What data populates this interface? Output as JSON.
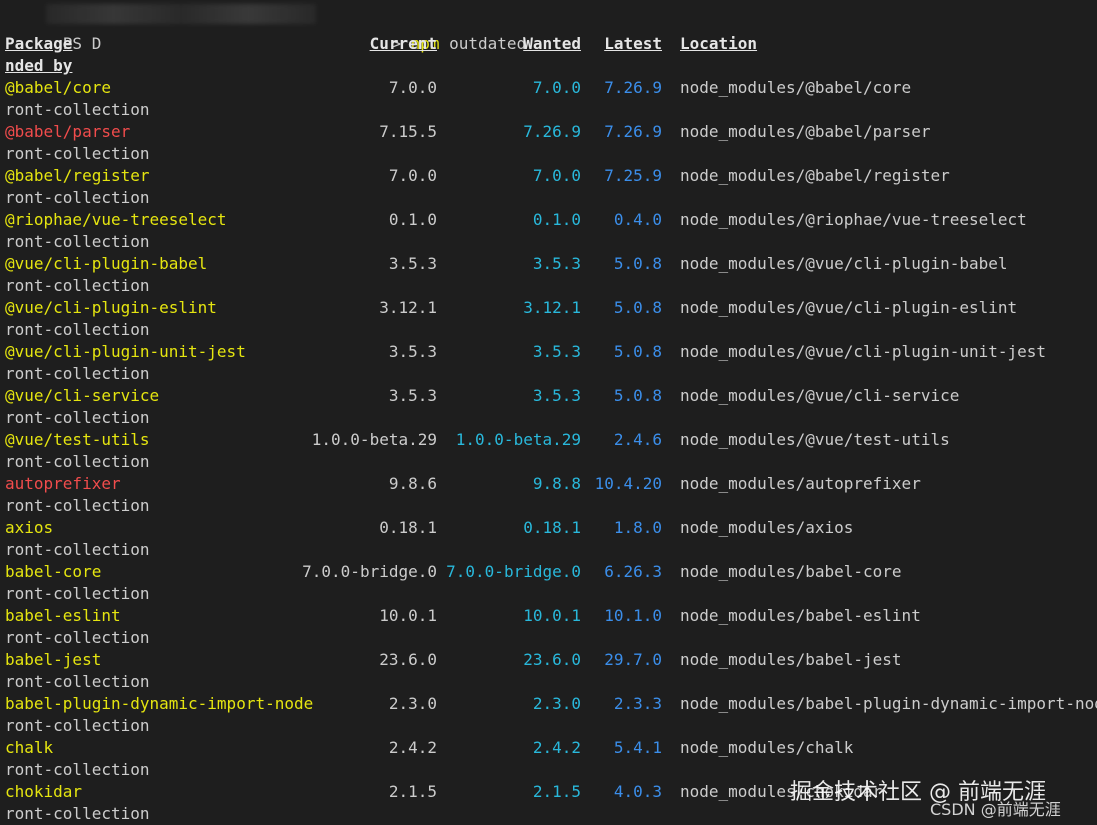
{
  "prompt": {
    "ps": "PS D",
    "gt": "> ",
    "cmd": "npm",
    "arg": " outdated"
  },
  "headers": {
    "package": "Package",
    "current": "Current",
    "wanted": "Wanted",
    "latest": "Latest",
    "location": "Location",
    "depended_by": "nded by"
  },
  "rows": [
    {
      "package": "@babel/core",
      "current": "7.0.0",
      "wanted": "7.0.0",
      "latest": "7.26.9",
      "location": "node_modules/@babel/core",
      "dep": "ront-collection",
      "color": "yellow"
    },
    {
      "package": "@babel/parser",
      "current": "7.15.5",
      "wanted": "7.26.9",
      "latest": "7.26.9",
      "location": "node_modules/@babel/parser",
      "dep": "ront-collection",
      "color": "red"
    },
    {
      "package": "@babel/register",
      "current": "7.0.0",
      "wanted": "7.0.0",
      "latest": "7.25.9",
      "location": "node_modules/@babel/register",
      "dep": "ront-collection",
      "color": "yellow"
    },
    {
      "package": "@riophae/vue-treeselect",
      "current": "0.1.0",
      "wanted": "0.1.0",
      "latest": "0.4.0",
      "location": "node_modules/@riophae/vue-treeselect",
      "dep": "ront-collection",
      "color": "yellow"
    },
    {
      "package": "@vue/cli-plugin-babel",
      "current": "3.5.3",
      "wanted": "3.5.3",
      "latest": "5.0.8",
      "location": "node_modules/@vue/cli-plugin-babel",
      "dep": "ront-collection",
      "color": "yellow"
    },
    {
      "package": "@vue/cli-plugin-eslint",
      "current": "3.12.1",
      "wanted": "3.12.1",
      "latest": "5.0.8",
      "location": "node_modules/@vue/cli-plugin-eslint",
      "dep": "ront-collection",
      "color": "yellow"
    },
    {
      "package": "@vue/cli-plugin-unit-jest",
      "current": "3.5.3",
      "wanted": "3.5.3",
      "latest": "5.0.8",
      "location": "node_modules/@vue/cli-plugin-unit-jest",
      "dep": "ront-collection",
      "color": "yellow"
    },
    {
      "package": "@vue/cli-service",
      "current": "3.5.3",
      "wanted": "3.5.3",
      "latest": "5.0.8",
      "location": "node_modules/@vue/cli-service",
      "dep": "ront-collection",
      "color": "yellow"
    },
    {
      "package": "@vue/test-utils",
      "current": "1.0.0-beta.29",
      "wanted": "1.0.0-beta.29",
      "latest": "2.4.6",
      "location": "node_modules/@vue/test-utils",
      "dep": "ront-collection",
      "color": "yellow"
    },
    {
      "package": "autoprefixer",
      "current": "9.8.6",
      "wanted": "9.8.8",
      "latest": "10.4.20",
      "location": "node_modules/autoprefixer",
      "dep": "ront-collection",
      "color": "red"
    },
    {
      "package": "axios",
      "current": "0.18.1",
      "wanted": "0.18.1",
      "latest": "1.8.0",
      "location": "node_modules/axios",
      "dep": "ront-collection",
      "color": "yellow"
    },
    {
      "package": "babel-core",
      "current": "7.0.0-bridge.0",
      "wanted": "7.0.0-bridge.0",
      "latest": "6.26.3",
      "location": "node_modules/babel-core",
      "dep": "ront-collection",
      "color": "yellow"
    },
    {
      "package": "babel-eslint",
      "current": "10.0.1",
      "wanted": "10.0.1",
      "latest": "10.1.0",
      "location": "node_modules/babel-eslint",
      "dep": "ront-collection",
      "color": "yellow"
    },
    {
      "package": "babel-jest",
      "current": "23.6.0",
      "wanted": "23.6.0",
      "latest": "29.7.0",
      "location": "node_modules/babel-jest",
      "dep": "ront-collection",
      "color": "yellow"
    },
    {
      "package": "babel-plugin-dynamic-import-node",
      "current": "2.3.0",
      "wanted": "2.3.0",
      "latest": "2.3.3",
      "location": "node_modules/babel-plugin-dynamic-import-node",
      "dep": "ront-collection",
      "color": "yellow"
    },
    {
      "package": "chalk",
      "current": "2.4.2",
      "wanted": "2.4.2",
      "latest": "5.4.1",
      "location": "node_modules/chalk",
      "dep": "ront-collection",
      "color": "yellow"
    },
    {
      "package": "chokidar",
      "current": "2.1.5",
      "wanted": "2.1.5",
      "latest": "4.0.3",
      "location": "node_modules/chokidar",
      "dep": "ront-collection",
      "color": "yellow"
    }
  ],
  "watermark": {
    "juejin": "掘金技术社区 @ 前端无涯",
    "csdn": "CSDN @前端无涯"
  }
}
